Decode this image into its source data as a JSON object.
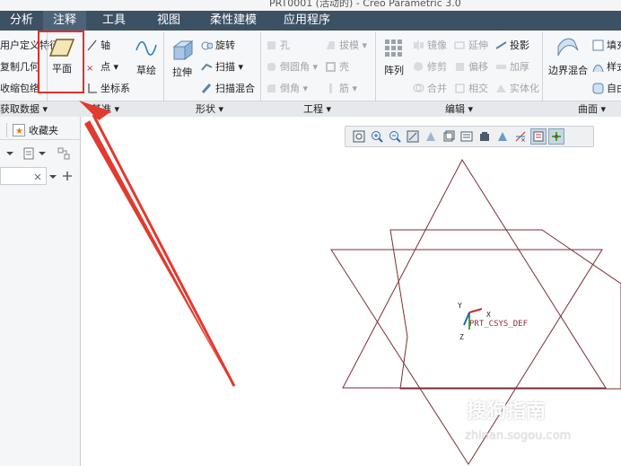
{
  "window": {
    "title": "PRT0001 (活动的) - Creo Parametric 3.0"
  },
  "tabs": [
    {
      "label": "分析",
      "active": false
    },
    {
      "label": "注释",
      "active": true
    },
    {
      "label": "工具",
      "active": false
    },
    {
      "label": "视图",
      "active": false
    },
    {
      "label": "柔性建模",
      "active": false
    },
    {
      "label": "应用程序",
      "active": false
    }
  ],
  "ribbon": {
    "data_group": {
      "items": [
        "用户定义特征",
        "复制几何",
        "收缩包络"
      ],
      "label": "获取数据 ▾"
    },
    "datum_group": {
      "plane_label": "平面",
      "axis_label": "轴",
      "point_label": "点 ▾",
      "csys_label": "坐标系",
      "sketch_label": "草绘",
      "label": "基准 ▾"
    },
    "shapes_group": {
      "extrude_label": "拉伸",
      "revolve_label": "旋转",
      "sweep_label": "扫描 ▾",
      "blend_label": "扫描混合",
      "label": "形状 ▾"
    },
    "engineering_group": {
      "hole_label": "孔",
      "round_label": "倒圆角 ▾",
      "chamfer_label": "倒角 ▾",
      "draft_label": "拔模 ▾",
      "shell_label": "壳",
      "rib_label": "筋 ▾",
      "label": "工程 ▾"
    },
    "editing_group": {
      "pattern_label": "阵列",
      "mirror_label": "镜像",
      "trim_label": "修剪",
      "merge_label": "合并",
      "extend_label": "延伸",
      "offset_label": "偏移",
      "intersect_label": "相交",
      "project_label": "投影",
      "thicken_label": "加厚",
      "solidify_label": "实体化",
      "label": "编辑 ▾"
    },
    "surfaces_group": {
      "boundary_label": "边界混合",
      "fill_label": "填充",
      "style_label": "样式",
      "freestyle_label": "自由式",
      "label": "曲面 ▾"
    }
  },
  "left_panel": {
    "tab_favorites": "收藏夹"
  },
  "model": {
    "csys_label": "PRT_CSYS_DEF",
    "axis_x": "X",
    "axis_y": "Y",
    "axis_z": "Z"
  },
  "watermark": {
    "brand": "搜狗指南",
    "url": "zhinan.sogou.com"
  },
  "colors": {
    "tabbar": "#3c5164",
    "geometry": "#7a2e35",
    "highlight": "#e0302a",
    "csys_green": "#2bb03a",
    "csys_label": "#8a2b35"
  }
}
